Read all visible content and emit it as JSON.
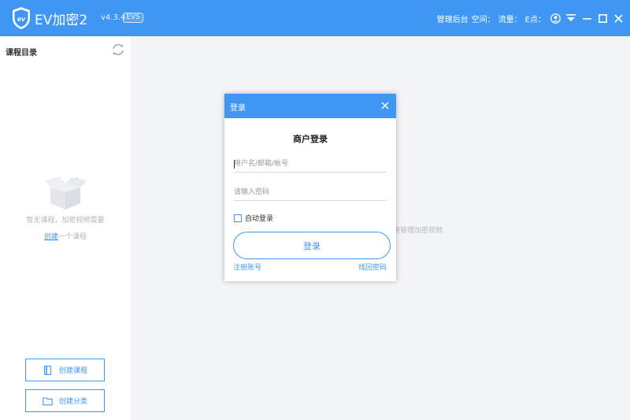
{
  "titlebar": {
    "app_name": "EV加密2",
    "version": "v4.3.4",
    "edition_badge": "EVS",
    "admin_link": "管理后台",
    "space_label": "空间：",
    "traffic_label": "流量：",
    "points_label": "E点：",
    "accent_color": "#3f97f3"
  },
  "sidebar": {
    "title": "课程目录",
    "empty_text": "暂无课程，加密视频需要",
    "create_link": "创建",
    "create_suffix": "一个课程",
    "create_course_button": "创建课程",
    "create_category_button": "创建分类"
  },
  "main": {
    "hint": "用管理加密视频"
  },
  "dialog": {
    "title": "登录",
    "heading": "商户登录",
    "username_placeholder": "用户名/邮箱/帐号",
    "password_placeholder": "请输入密码",
    "auto_login_label": "自动登录",
    "login_button": "登录",
    "register_link": "注册账号",
    "forgot_link": "找回密码"
  }
}
